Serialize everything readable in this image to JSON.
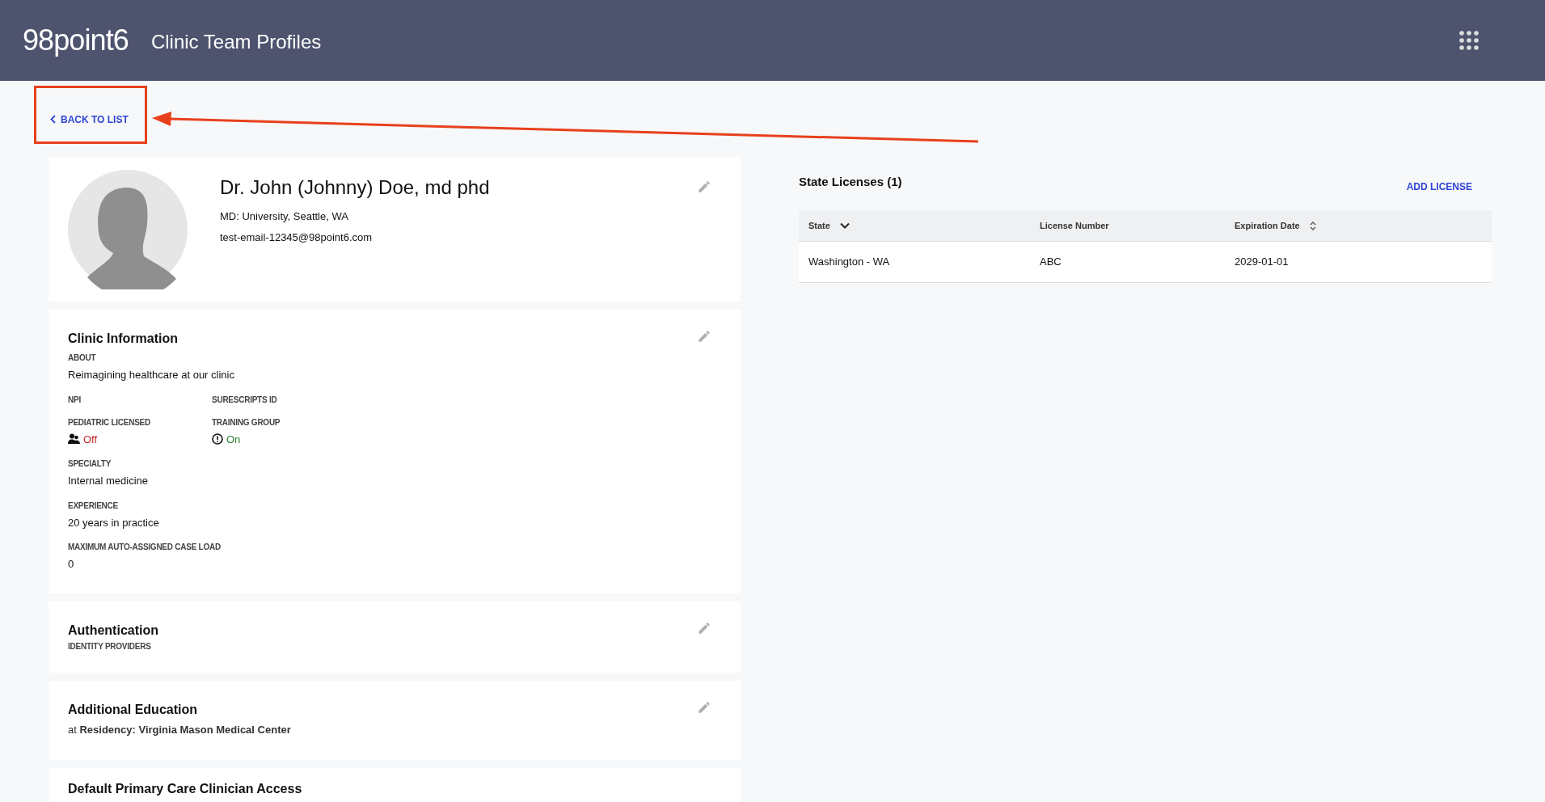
{
  "header": {
    "logo": "98point6",
    "title": "Clinic Team Profiles"
  },
  "back_link": {
    "label": "BACK TO LIST"
  },
  "annotation": {
    "kind": "arrow"
  },
  "profile": {
    "name": "Dr. John (Johnny) Doe, md phd",
    "degree": "MD: University, Seattle, WA",
    "email": "test-email-12345@98point6.com"
  },
  "clinic_information": {
    "title": "Clinic Information",
    "fields": [
      {
        "kind": "text",
        "label": "ABOUT",
        "value": "Reimagining healthcare at our clinic"
      },
      {
        "kind": "pair",
        "items": [
          {
            "label": "NPI"
          },
          {
            "label": "SURESCRIPTS ID"
          }
        ]
      },
      {
        "kind": "toggles",
        "items": [
          {
            "label": "PEDIATRIC LICENSED",
            "value": "Off",
            "on": false
          },
          {
            "label": "TRAINING GROUP",
            "value": "On",
            "on": true
          }
        ]
      },
      {
        "kind": "text",
        "label": "SPECIALTY",
        "value": "Internal medicine"
      },
      {
        "kind": "text",
        "label": "EXPERIENCE",
        "value": "20 years in practice"
      },
      {
        "kind": "text",
        "label": "MAXIMUM AUTO-ASSIGNED CASE LOAD",
        "value": "0"
      }
    ]
  },
  "authentication": {
    "title": "Authentication",
    "label": "IDENTITY PROVIDERS"
  },
  "additional_education": {
    "title": "Additional Education",
    "text": "at **Residency: Virginia Mason Medical Center**"
  },
  "default_access": {
    "title": "Default Primary Care Clinician Access"
  },
  "state_licenses": {
    "title": "State Licenses (1)",
    "add_button": "ADD LICENSE",
    "columns": [
      {
        "label": "State",
        "sorted": true
      },
      {
        "label": "License Number",
        "sorted": false,
        "sortable": false
      },
      {
        "label": "Expiration Date",
        "sorted": false,
        "sortable": true
      }
    ],
    "rows": [
      [
        "Washington - WA",
        "ABC",
        "2029-01-01"
      ]
    ]
  }
}
